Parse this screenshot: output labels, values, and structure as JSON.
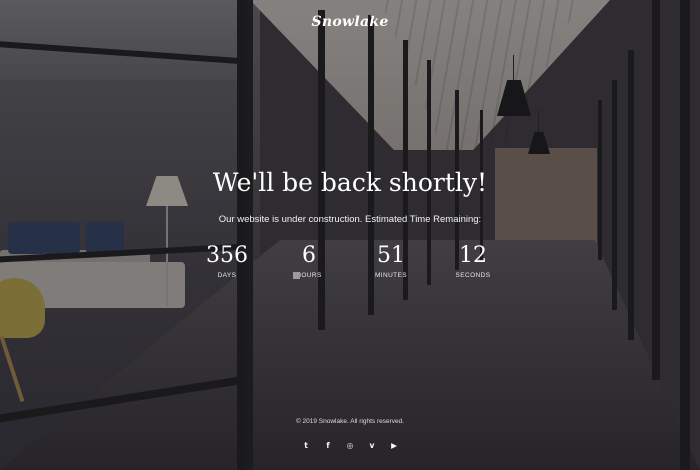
{
  "brand": {
    "logo": "Snowlake"
  },
  "hero": {
    "headline": "We'll be back shortly!",
    "subline": "Our website is under construction. Estimated Time Remaining:"
  },
  "countdown": [
    {
      "value": "356",
      "label": "DAYS"
    },
    {
      "value": "6",
      "label": "HOURS"
    },
    {
      "value": "51",
      "label": "MINUTES"
    },
    {
      "value": "12",
      "label": "SECONDS"
    }
  ],
  "footer": {
    "copyright": "© 2019 Snowlake. All rights reserved.",
    "social": [
      {
        "name": "twitter-icon",
        "glyph": "t"
      },
      {
        "name": "facebook-icon",
        "glyph": "f"
      },
      {
        "name": "instagram-icon",
        "glyph": "◎"
      },
      {
        "name": "vimeo-icon",
        "glyph": "v"
      },
      {
        "name": "youtube-icon",
        "glyph": "▶"
      }
    ]
  },
  "colors": {
    "text": "#ffffff",
    "overlay": "#1e1c22"
  }
}
